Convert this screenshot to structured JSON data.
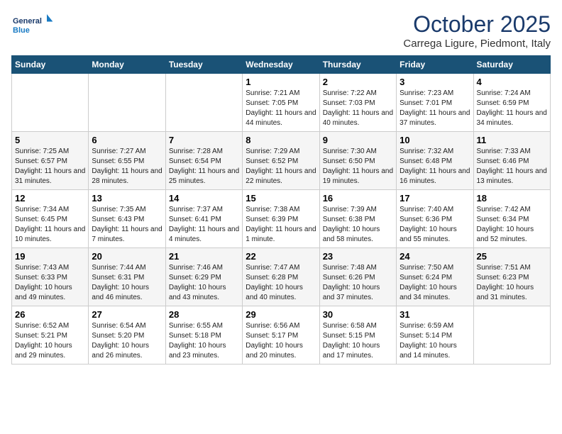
{
  "logo": {
    "line1": "General",
    "line2": "Blue"
  },
  "title": "October 2025",
  "subtitle": "Carrega Ligure, Piedmont, Italy",
  "days_of_week": [
    "Sunday",
    "Monday",
    "Tuesday",
    "Wednesday",
    "Thursday",
    "Friday",
    "Saturday"
  ],
  "weeks": [
    [
      {
        "day": "",
        "info": ""
      },
      {
        "day": "",
        "info": ""
      },
      {
        "day": "",
        "info": ""
      },
      {
        "day": "1",
        "info": "Sunrise: 7:21 AM\nSunset: 7:05 PM\nDaylight: 11 hours and 44 minutes."
      },
      {
        "day": "2",
        "info": "Sunrise: 7:22 AM\nSunset: 7:03 PM\nDaylight: 11 hours and 40 minutes."
      },
      {
        "day": "3",
        "info": "Sunrise: 7:23 AM\nSunset: 7:01 PM\nDaylight: 11 hours and 37 minutes."
      },
      {
        "day": "4",
        "info": "Sunrise: 7:24 AM\nSunset: 6:59 PM\nDaylight: 11 hours and 34 minutes."
      }
    ],
    [
      {
        "day": "5",
        "info": "Sunrise: 7:25 AM\nSunset: 6:57 PM\nDaylight: 11 hours and 31 minutes."
      },
      {
        "day": "6",
        "info": "Sunrise: 7:27 AM\nSunset: 6:55 PM\nDaylight: 11 hours and 28 minutes."
      },
      {
        "day": "7",
        "info": "Sunrise: 7:28 AM\nSunset: 6:54 PM\nDaylight: 11 hours and 25 minutes."
      },
      {
        "day": "8",
        "info": "Sunrise: 7:29 AM\nSunset: 6:52 PM\nDaylight: 11 hours and 22 minutes."
      },
      {
        "day": "9",
        "info": "Sunrise: 7:30 AM\nSunset: 6:50 PM\nDaylight: 11 hours and 19 minutes."
      },
      {
        "day": "10",
        "info": "Sunrise: 7:32 AM\nSunset: 6:48 PM\nDaylight: 11 hours and 16 minutes."
      },
      {
        "day": "11",
        "info": "Sunrise: 7:33 AM\nSunset: 6:46 PM\nDaylight: 11 hours and 13 minutes."
      }
    ],
    [
      {
        "day": "12",
        "info": "Sunrise: 7:34 AM\nSunset: 6:45 PM\nDaylight: 11 hours and 10 minutes."
      },
      {
        "day": "13",
        "info": "Sunrise: 7:35 AM\nSunset: 6:43 PM\nDaylight: 11 hours and 7 minutes."
      },
      {
        "day": "14",
        "info": "Sunrise: 7:37 AM\nSunset: 6:41 PM\nDaylight: 11 hours and 4 minutes."
      },
      {
        "day": "15",
        "info": "Sunrise: 7:38 AM\nSunset: 6:39 PM\nDaylight: 11 hours and 1 minute."
      },
      {
        "day": "16",
        "info": "Sunrise: 7:39 AM\nSunset: 6:38 PM\nDaylight: 10 hours and 58 minutes."
      },
      {
        "day": "17",
        "info": "Sunrise: 7:40 AM\nSunset: 6:36 PM\nDaylight: 10 hours and 55 minutes."
      },
      {
        "day": "18",
        "info": "Sunrise: 7:42 AM\nSunset: 6:34 PM\nDaylight: 10 hours and 52 minutes."
      }
    ],
    [
      {
        "day": "19",
        "info": "Sunrise: 7:43 AM\nSunset: 6:33 PM\nDaylight: 10 hours and 49 minutes."
      },
      {
        "day": "20",
        "info": "Sunrise: 7:44 AM\nSunset: 6:31 PM\nDaylight: 10 hours and 46 minutes."
      },
      {
        "day": "21",
        "info": "Sunrise: 7:46 AM\nSunset: 6:29 PM\nDaylight: 10 hours and 43 minutes."
      },
      {
        "day": "22",
        "info": "Sunrise: 7:47 AM\nSunset: 6:28 PM\nDaylight: 10 hours and 40 minutes."
      },
      {
        "day": "23",
        "info": "Sunrise: 7:48 AM\nSunset: 6:26 PM\nDaylight: 10 hours and 37 minutes."
      },
      {
        "day": "24",
        "info": "Sunrise: 7:50 AM\nSunset: 6:24 PM\nDaylight: 10 hours and 34 minutes."
      },
      {
        "day": "25",
        "info": "Sunrise: 7:51 AM\nSunset: 6:23 PM\nDaylight: 10 hours and 31 minutes."
      }
    ],
    [
      {
        "day": "26",
        "info": "Sunrise: 6:52 AM\nSunset: 5:21 PM\nDaylight: 10 hours and 29 minutes."
      },
      {
        "day": "27",
        "info": "Sunrise: 6:54 AM\nSunset: 5:20 PM\nDaylight: 10 hours and 26 minutes."
      },
      {
        "day": "28",
        "info": "Sunrise: 6:55 AM\nSunset: 5:18 PM\nDaylight: 10 hours and 23 minutes."
      },
      {
        "day": "29",
        "info": "Sunrise: 6:56 AM\nSunset: 5:17 PM\nDaylight: 10 hours and 20 minutes."
      },
      {
        "day": "30",
        "info": "Sunrise: 6:58 AM\nSunset: 5:15 PM\nDaylight: 10 hours and 17 minutes."
      },
      {
        "day": "31",
        "info": "Sunrise: 6:59 AM\nSunset: 5:14 PM\nDaylight: 10 hours and 14 minutes."
      },
      {
        "day": "",
        "info": ""
      }
    ]
  ]
}
